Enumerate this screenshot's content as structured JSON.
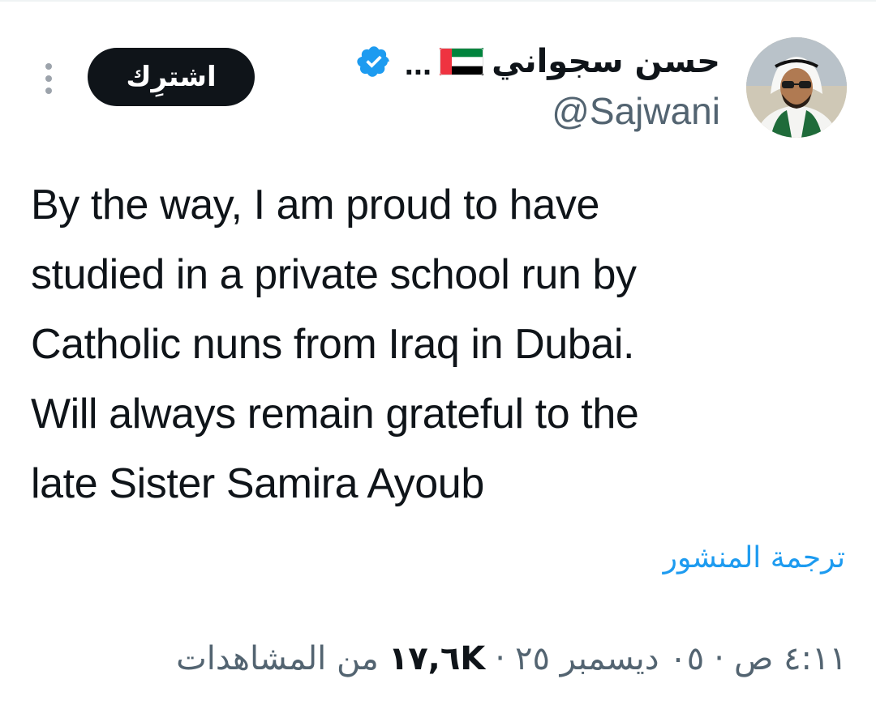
{
  "author": {
    "display_name": "حسن سجواني",
    "ellipsis": "...",
    "handle": "@Sajwani",
    "flag": "uae-flag-emoji",
    "verified_icon": "verified-badge-icon",
    "verified_color": "#1d9bf0"
  },
  "header": {
    "subscribe_label": "اشترِك",
    "more_icon": "more-vertical-icon"
  },
  "tweet": {
    "lines": [
      "By the way, I am proud to have",
      "studied in a private school run by",
      "Catholic nuns from Iraq in Dubai.",
      "Will always remain grateful to the",
      "late Sister Samira Ayoub"
    ],
    "translate_label": "ترجمة المنشور"
  },
  "meta": {
    "time": "٤:١١ ص",
    "separator": "·",
    "date": "٠٥ ديسمبر ٢٥",
    "views_count": "١٧,٦K",
    "views_label": "من المشاهدات"
  },
  "colors": {
    "text": "#0f1419",
    "secondary": "#536471",
    "link": "#1d9bf0",
    "button_bg": "#0f1419"
  }
}
